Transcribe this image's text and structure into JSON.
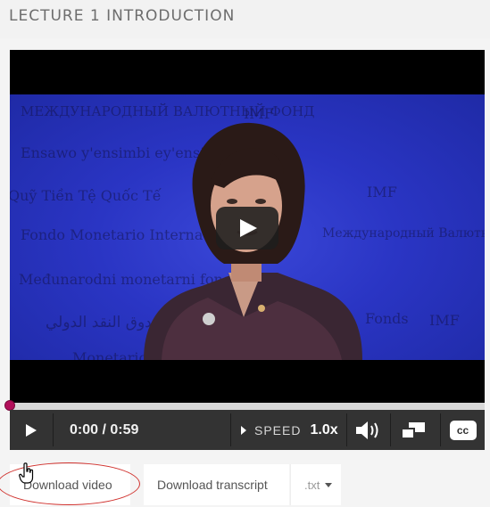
{
  "header": {
    "title": "LECTURE 1 INTRODUCTION"
  },
  "video": {
    "background_words": [
      "MEЖДУНАРОДНЫЙ ВАЛЮТНЫЙ ФОНД",
      "IMF",
      "Ensawo y'ensimbi ey'ensi yonna",
      "Quỹ Tiền Tệ Quốc Tế",
      "IMF",
      "Fondo Monetario Internacional",
      "Международный Валютный Фонд",
      "Međunarodni monetarni fond",
      "صندوق النقد الدولي",
      "Fonds",
      "IMF",
      "Monetario"
    ],
    "accent_color": "#2a35c4"
  },
  "player": {
    "play_overlay_icon": "play-icon",
    "progress_fraction": 0.0,
    "scrubber_color": "#b20f5a",
    "play_button_icon": "play-icon",
    "time_display": "0:00 / 0:59",
    "speed_label": "SPEED",
    "speed_value": "1.0x",
    "volume_icon": "volume-icon",
    "fullscreen_icon": "resize-icon",
    "cc_label": "cc"
  },
  "downloads": {
    "video_label": "Download video",
    "transcript_label": "Download transcript",
    "format_value": ".txt"
  }
}
